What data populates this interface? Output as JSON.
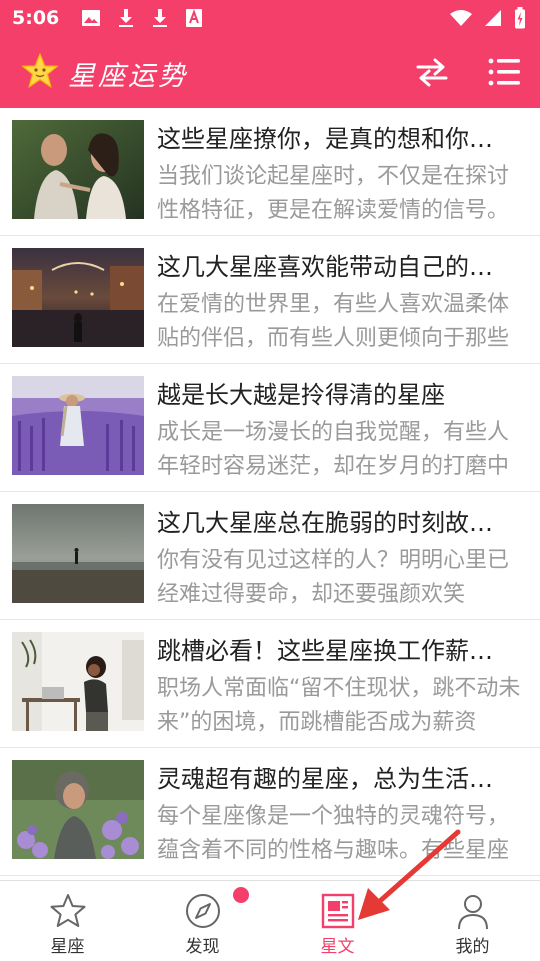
{
  "status_bar": {
    "time": "5:06"
  },
  "app_bar": {
    "title": "星座运势"
  },
  "articles": [
    {
      "title": "这些星座撩你，是真的想和你…",
      "summary": "当我们谈论起星座时，不仅是在探讨性格特征，更是在解读爱情的信号。"
    },
    {
      "title": "这几大星座喜欢能带动自己的…",
      "summary": "在爱情的世界里，有些人喜欢温柔体贴的伴侣，而有些人则更倾向于那些"
    },
    {
      "title": "越是长大越是拎得清的星座",
      "summary": "成长是一场漫长的自我觉醒，有些人年轻时容易迷茫，却在岁月的打磨中"
    },
    {
      "title": "这几大星座总在脆弱的时刻故…",
      "summary": "你有没有见过这样的人？明明心里已经难过得要命，却还要强颜欢笑"
    },
    {
      "title": "跳槽必看！这些星座换工作薪…",
      "summary": "职场人常面临“留不住现状，跳不动未来”的困境，而跳槽能否成为薪资"
    },
    {
      "title": "灵魂超有趣的星座，总为生活…",
      "summary": "每个星座像是一个独特的灵魂符号，蕴含着不同的性格与趣味。有些星座"
    }
  ],
  "tabs": [
    {
      "label": "星座",
      "icon": "star-icon"
    },
    {
      "label": "发现",
      "icon": "compass-icon"
    },
    {
      "label": "星文",
      "icon": "article-icon"
    },
    {
      "label": "我的",
      "icon": "profile-icon"
    }
  ],
  "colors": {
    "accent": "#f43f6a",
    "title_text": "#222222",
    "summary_text": "#9a9a9a",
    "annotation": "#e53935"
  }
}
